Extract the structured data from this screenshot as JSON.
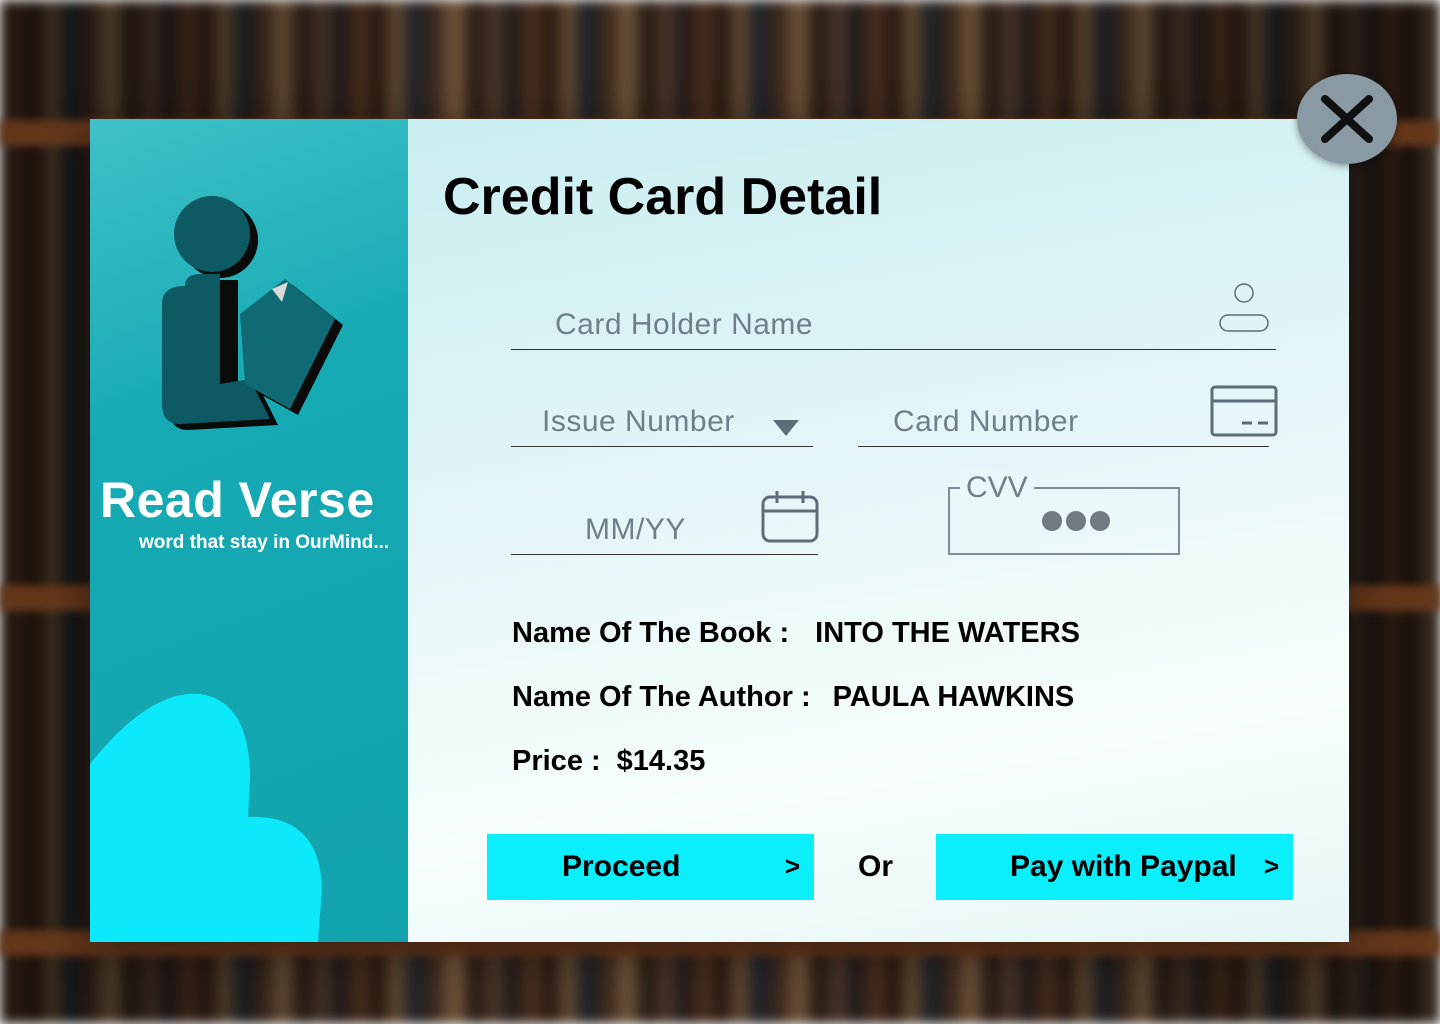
{
  "brand": {
    "title": "Read Verse",
    "tagline": "word that stay in OurMind..."
  },
  "form": {
    "title": "Credit Card Detail",
    "card_holder_placeholder": "Card Holder Name",
    "issue_number_placeholder": "Issue Number",
    "card_number_placeholder": "Card Number",
    "expiry_placeholder": "MM/YY",
    "cvv_label": "CVV"
  },
  "order": {
    "book_label": "Name Of The Book :",
    "book_value": "INTO THE WATERS",
    "author_label": "Name Of The Author :",
    "author_value": "PAULA HAWKINS",
    "price_label": "Price :",
    "price_value": "$14.35"
  },
  "actions": {
    "proceed_label": "Proceed",
    "proceed_chevron": ">",
    "or_label": "Or",
    "paypal_label": "Pay with Paypal",
    "paypal_chevron": ">"
  },
  "icons": {
    "close": "close-icon",
    "user": "user-icon",
    "card": "credit-card-icon",
    "calendar": "calendar-icon",
    "dropdown": "dropdown-arrow-icon",
    "logo": "reader-logo"
  },
  "colors": {
    "left_panel": "#16aab4",
    "button": "#0beefc",
    "blob": "#0ce9fb",
    "close_bg": "#8a9aa4"
  }
}
